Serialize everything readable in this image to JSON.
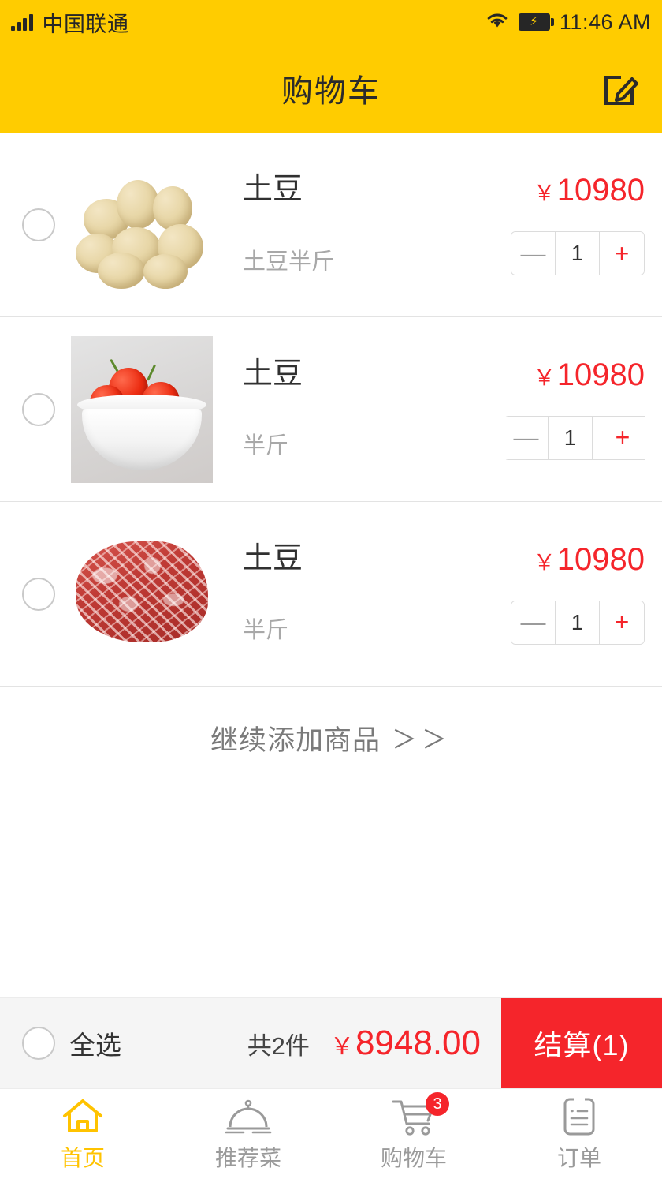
{
  "status_bar": {
    "carrier": "中国联通",
    "time": "11:46 AM",
    "signal_icon": "signal-bars-icon",
    "wifi_icon": "wifi-icon",
    "battery_icon": "battery-charging-icon"
  },
  "header": {
    "title": "购物车",
    "edit_icon": "edit-square-icon",
    "background_color": "#FFCC00"
  },
  "cart": {
    "items": [
      {
        "name": "土豆",
        "spec": "土豆半斤",
        "price": "10980",
        "currency": "￥",
        "quantity": "1",
        "selected": false,
        "image": "potatoes-photo",
        "minus_label": "—",
        "plus_label": "+"
      },
      {
        "name": "土豆",
        "spec": "半斤",
        "price": "10980",
        "currency": "￥",
        "quantity": "1",
        "selected": false,
        "image": "tomatoes-in-bowl-photo",
        "minus_label": "—",
        "plus_label": "+"
      },
      {
        "name": "土豆",
        "spec": "半斤",
        "price": "10980",
        "currency": "￥",
        "quantity": "1",
        "selected": false,
        "image": "raw-beef-steak-photo",
        "minus_label": "—",
        "plus_label": "+"
      }
    ],
    "continue_label": "继续添加商品",
    "continue_chevrons": "＞＞"
  },
  "checkout": {
    "select_all_label": "全选",
    "select_all_checked": false,
    "count_label": "共2件",
    "total_currency": "￥",
    "total_amount": "8948.00",
    "submit_label": "结算(1)",
    "accent_color": "#f5252b"
  },
  "tabbar": {
    "tabs": [
      {
        "label": "首页",
        "icon": "home-icon",
        "active": true,
        "badge": ""
      },
      {
        "label": "推荐菜",
        "icon": "cloche-dish-icon",
        "active": false,
        "badge": ""
      },
      {
        "label": "购物车",
        "icon": "shopping-cart-icon",
        "active": false,
        "badge": "3"
      },
      {
        "label": "订单",
        "icon": "order-list-icon",
        "active": false,
        "badge": ""
      }
    ],
    "active_color": "#FFC300",
    "inactive_color": "#9a9a9a"
  }
}
